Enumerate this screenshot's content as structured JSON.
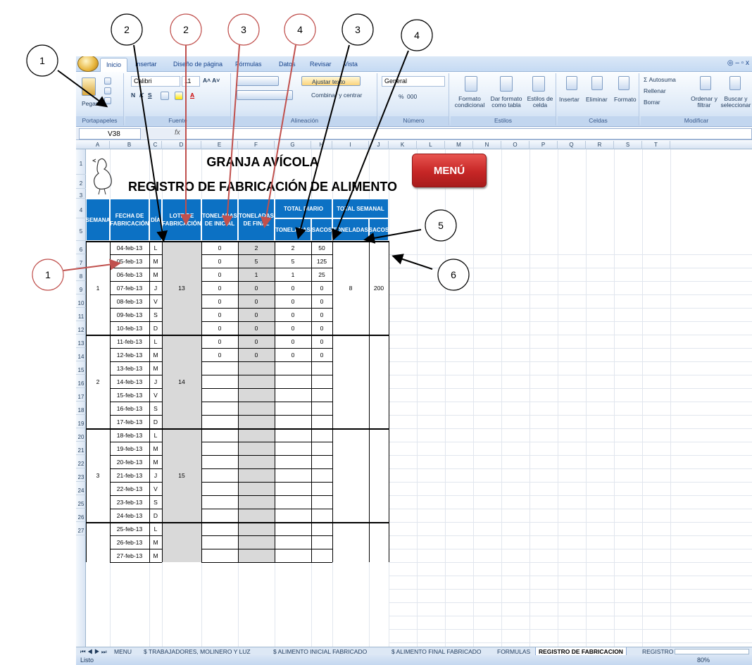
{
  "ribbon": {
    "tabs": [
      "Inicio",
      "Insertar",
      "Diseño de página",
      "Fórmulas",
      "Datos",
      "Revisar",
      "Vista"
    ],
    "window_controls": "◎ – ▫ x",
    "clipboard": {
      "paste": "Pegar",
      "group": "Portapapeles"
    },
    "font": {
      "name": "Calibri",
      "size": "11",
      "group": "Fuente"
    },
    "alignment": {
      "wrap": "Ajustar texto",
      "merge": "Combinar y centrar",
      "group": "Alineación"
    },
    "number": {
      "format": "General",
      "pct": "%",
      "thousands": "000",
      "group": "Número"
    },
    "styles": {
      "cond": "Formato condicional",
      "table": "Dar formato como tabla",
      "cell": "Estilos de celda",
      "group": "Estilos"
    },
    "cells": {
      "insert": "Insertar",
      "delete": "Eliminar",
      "format": "Formato",
      "group": "Celdas"
    },
    "editing": {
      "autosum": "Σ Autosuma",
      "fill": "Rellenar",
      "clear": "Borrar",
      "sort": "Ordenar y filtrar",
      "find": "Buscar y seleccionar",
      "group": "Modificar"
    }
  },
  "formula_bar": {
    "name_box": "V38",
    "fx": "fx",
    "value": ""
  },
  "columns": [
    "A",
    "B",
    "C",
    "D",
    "E",
    "F",
    "G",
    "H",
    "I",
    "J",
    "K",
    "L",
    "M",
    "N",
    "O",
    "P",
    "Q",
    "R",
    "S",
    "T"
  ],
  "rows": [
    "1",
    "2",
    "3",
    "4",
    "5",
    "6",
    "7",
    "8",
    "9",
    "10",
    "11",
    "12",
    "13",
    "14",
    "15",
    "16",
    "17",
    "18",
    "19",
    "20",
    "21",
    "22",
    "23",
    "24",
    "25",
    "26",
    "27"
  ],
  "sheet": {
    "title": "GRANJA AVÍCOLA",
    "subtitle": "REGISTRO DE FABRICACIÓN DE ALIMENTO",
    "menu_button": "MENÚ",
    "headers": {
      "semana": "SEMANA",
      "fecha": "FECHA DE FABRICACIÓN",
      "dia": "DÍA",
      "lote": "LOTE DE FABRICACIÓN",
      "ton_inicial": "TONELADAS DE INICIAL",
      "ton_final": "TONELADAS DE FINAL",
      "total_diario": "TOTAL DIARIO",
      "total_semanal": "TOTAL SEMANAL",
      "toneladas": "TONELADAS",
      "sacos": "SACOS"
    },
    "dates": [
      "04-feb-13",
      "05-feb-13",
      "06-feb-13",
      "07-feb-13",
      "08-feb-13",
      "09-feb-13",
      "10-feb-13",
      "11-feb-13",
      "12-feb-13",
      "13-feb-13",
      "14-feb-13",
      "15-feb-13",
      "16-feb-13",
      "17-feb-13",
      "18-feb-13",
      "19-feb-13",
      "20-feb-13",
      "21-feb-13",
      "22-feb-13",
      "23-feb-13",
      "24-feb-13",
      "25-feb-13",
      "26-feb-13",
      "27-feb-13"
    ],
    "days": [
      "L",
      "M",
      "M",
      "J",
      "V",
      "S",
      "D",
      "L",
      "M",
      "M",
      "J",
      "V",
      "S",
      "D",
      "L",
      "M",
      "M",
      "J",
      "V",
      "S",
      "D",
      "L",
      "M",
      "M"
    ],
    "ton_inicial": [
      "0",
      "0",
      "0",
      "0",
      "0",
      "0",
      "0",
      "0",
      "0"
    ],
    "ton_final": [
      "2",
      "5",
      "1",
      "0",
      "0",
      "0",
      "0",
      "0",
      "0"
    ],
    "diario_ton": [
      "2",
      "5",
      "1",
      "0",
      "0",
      "0",
      "0",
      "0",
      "0"
    ],
    "diario_sacos": [
      "50",
      "125",
      "25",
      "0",
      "0",
      "0",
      "0",
      "0",
      "0"
    ],
    "weeks": [
      {
        "semana": "1",
        "lote": "13",
        "sem_ton": "8",
        "sem_sacos": "200"
      },
      {
        "semana": "2",
        "lote": "14",
        "sem_ton": "",
        "sem_sacos": ""
      },
      {
        "semana": "3",
        "lote": "15",
        "sem_ton": "",
        "sem_sacos": ""
      }
    ]
  },
  "sheet_tabs": [
    "MENU",
    "$ TRABAJADORES, MOLINERO Y LUZ",
    "$ ALIMENTO INICIAL FABRICADO",
    "$ ALIMENTO FINAL FABRICADO",
    "FORMULAS",
    "REGISTRO DE FABRICACION",
    "REGISTRO"
  ],
  "status": {
    "ready": "Listo",
    "zoom": "80%"
  },
  "annotations": [
    "1",
    "2",
    "2",
    "3",
    "4",
    "3",
    "4",
    "1",
    "5",
    "6"
  ]
}
